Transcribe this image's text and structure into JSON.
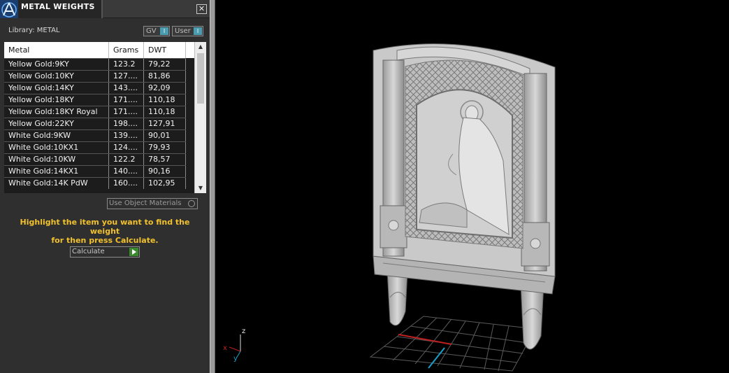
{
  "panel": {
    "title": "METAL WEIGHTS",
    "close_glyph": "✕",
    "library_label": "Library: METAL",
    "toggles": [
      {
        "label": "GV",
        "state": "I"
      },
      {
        "label": "User",
        "state": "I"
      }
    ],
    "table": {
      "headers": [
        "Metal",
        "Grams",
        "DWT"
      ],
      "rows": [
        {
          "metal": "Yellow Gold:9KY",
          "grams": "123.2",
          "dwt": "79,22"
        },
        {
          "metal": "Yellow Gold:10KY",
          "grams": "127....",
          "dwt": "81,86"
        },
        {
          "metal": "Yellow Gold:14KY",
          "grams": "143....",
          "dwt": "92,09"
        },
        {
          "metal": "Yellow Gold:18KY",
          "grams": "171....",
          "dwt": "110,18"
        },
        {
          "metal": "Yellow Gold:18KY Royal",
          "grams": "171....",
          "dwt": "110,18"
        },
        {
          "metal": "Yellow Gold:22KY",
          "grams": "198....",
          "dwt": "127,91"
        },
        {
          "metal": "White Gold:9KW",
          "grams": "139....",
          "dwt": "90,01"
        },
        {
          "metal": "White Gold:10KX1",
          "grams": "124....",
          "dwt": "79,93"
        },
        {
          "metal": "White Gold:10KW",
          "grams": "122.2",
          "dwt": "78,57"
        },
        {
          "metal": "White Gold:14KX1",
          "grams": "140....",
          "dwt": "90,16"
        },
        {
          "metal": "White Gold:14K PdW",
          "grams": "160....",
          "dwt": "102,95"
        }
      ]
    },
    "use_object_materials": "Use Object Materials",
    "hint_line1": "Highlight the item you want to find the weight",
    "hint_line2": "for then press Calculate.",
    "calculate_label": "Calculate"
  },
  "viewport": {
    "axes": {
      "z": "z",
      "x": "x",
      "y": "y"
    }
  }
}
